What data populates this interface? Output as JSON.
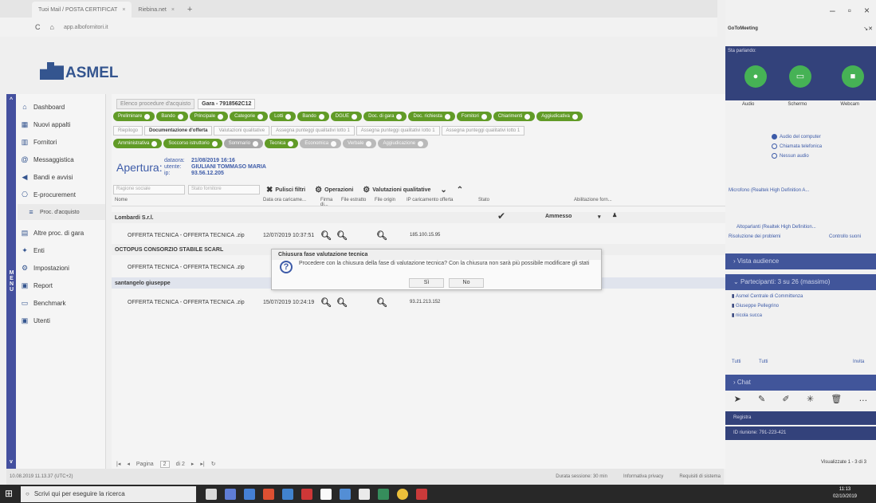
{
  "browser": {
    "tabs": [
      "Tuoi Mail / POSTA CERTIFICAT",
      "Riebina.net"
    ],
    "url": "app.albofornitori.it",
    "nav": [
      "C",
      "⌂"
    ]
  },
  "app": {
    "logo_text": "ASMEL",
    "menu_vertical": "MENU"
  },
  "sidebar": {
    "items": [
      {
        "label": "Dashboard",
        "icon": "home-icon"
      },
      {
        "label": "Nuovi appalti",
        "icon": "grid-icon"
      },
      {
        "label": "Fornitori",
        "icon": "bars-icon"
      },
      {
        "label": "Messaggistica",
        "icon": "email-icon"
      },
      {
        "label": "Bandi e avvisi",
        "icon": "megaphone-icon"
      },
      {
        "label": "E-procurement",
        "icon": "procurement-icon"
      },
      {
        "label": "Proc. d'acquisto",
        "icon": "list-icon",
        "sub": true
      },
      {
        "label": "Altre proc. di gara",
        "icon": "folder-icon"
      },
      {
        "label": "Enti",
        "icon": "org-icon"
      },
      {
        "label": "Impostazioni",
        "icon": "gear-icon"
      },
      {
        "label": "Report",
        "icon": "report-icon"
      },
      {
        "label": "Benchmark",
        "icon": "document-icon"
      },
      {
        "label": "Utenti",
        "icon": "users-icon"
      }
    ]
  },
  "breadcrumbs": [
    "Elenco procedure d'acquisto",
    "Gara - 7918562C12"
  ],
  "green_tabs_1": [
    {
      "label": "Preliminare",
      "state": "ok"
    },
    {
      "label": "Bando",
      "state": "ok"
    },
    {
      "label": "Principale",
      "state": "ok"
    },
    {
      "label": "Categorie",
      "state": "ok"
    },
    {
      "label": "Lotti",
      "state": "ok"
    },
    {
      "label": "Bando",
      "state": "ok"
    },
    {
      "label": "DGUE",
      "state": "ok"
    },
    {
      "label": "Doc. di gara",
      "state": "ok"
    },
    {
      "label": "Doc. richiesta",
      "state": "ok"
    },
    {
      "label": "Fornitori",
      "state": "ok"
    },
    {
      "label": "Chiarimenti",
      "state": "ok"
    },
    {
      "label": "Aggiudicativa",
      "state": "ok"
    }
  ],
  "white_tabs": [
    "Riepilogo",
    "Documentazione d'offerta",
    "Valutazioni qualitative",
    "Assegna punteggi qualitativi lotto 1",
    "Assegna punteggi qualitativi lotto 1",
    "Assegna punteggi qualitativi lotto 1"
  ],
  "green_tabs_2": [
    {
      "label": "Amministrativa",
      "state": "ok"
    },
    {
      "label": "Soccorso istruttorio",
      "state": "ok"
    },
    {
      "label": "Sommario",
      "state": "muted"
    },
    {
      "label": "Tecnica",
      "state": "ok"
    },
    {
      "label": "Economica",
      "state": "dim"
    },
    {
      "label": "Verbale",
      "state": "dim"
    },
    {
      "label": "Aggiudicazione",
      "state": "dim"
    }
  ],
  "apertura": {
    "title": "Apertura:",
    "dataora_label": "dataora:",
    "dataora": "21/08/2019 16:16",
    "utente_label": "utente:",
    "utente": "GIULIANI TOMMASO MARIA",
    "ip_label": "ip:",
    "ip": "93.56.12.205"
  },
  "filters": {
    "search_placeholder": "Ragione sociale",
    "state_placeholder": "Stato fornitore",
    "reset": "Pulisci filtri",
    "operazioni": "Operazioni",
    "valutazioni": "Valutazioni qualitative"
  },
  "table": {
    "headers": [
      "Nome",
      "Data ora caricame...",
      "Firma di...",
      "File estratto",
      "File origin",
      "IP caricamento offerta",
      "Stato",
      "",
      "Abilitazione forn..."
    ],
    "groups": [
      {
        "name": "Lombardi S.r.l.",
        "status": "Ammesso",
        "file": "OFFERTA TECNICA - OFFERTA TECNICA .zip",
        "date": "12/07/2019 10:37:51",
        "ip": "185.100.15.95"
      },
      {
        "name": "OCTOPUS CONSORZIO STABILE SCARL",
        "file": "OFFERTA TECNICA - OFFERTA TECNICA .zip",
        "date": "",
        "ip": ""
      },
      {
        "name": "santangelo giuseppe",
        "file": "OFFERTA TECNICA - OFFERTA TECNICA .zip",
        "date": "15/07/2019 10:24:19",
        "ip": "93.21.213.152"
      }
    ]
  },
  "dialog": {
    "title": "Chiusura fase valutazione tecnica",
    "message": "Procedere con la chiusura della fase di valutazione tecnica? Con la chiusura non sarà più possibile modificare gli stati",
    "yes": "Sì",
    "no": "No"
  },
  "pager": {
    "page_label": "Pagina",
    "page": "2",
    "of": "di 2",
    "visual": "Visualizzate 1 - 3 di 3"
  },
  "footer": {
    "left": "10.08.2019 11.13.37 (UTC+2)",
    "session": "Durata sessione: 30 min",
    "privacy": "Informativa privacy",
    "req": "Requisiti di sistema"
  },
  "goto": {
    "title": "GoToMeeting",
    "speaking": "Sta parlando:",
    "audio": "Audio",
    "screen": "Schermo",
    "webcam": "Webcam",
    "opt1": "Audio del computer",
    "opt2": "Chiamata telefonica",
    "opt3": "Nessun audio",
    "mic": "Microfono (Realtek High Definition A...",
    "speaker": "Altoparlanti (Realtek High Definition...",
    "troubleshoot": "Risoluzione dei problemi",
    "controls": "Controllo suoni",
    "audience": "Vista audience",
    "participants": "Partecipanti: 3 su 26 (massimo)",
    "people": [
      "Asmel Centrale di Committenza",
      "Giuseppe Pellegrino",
      "nicola succa"
    ],
    "all1": "Tutti",
    "all2": "Tutti",
    "invite": "Invita",
    "chat": "Chat",
    "record": "Registra",
    "meeting_id": "ID riunione: 791-223-421"
  },
  "taskbar": {
    "search": "Scrivi qui per eseguire la ricerca",
    "time": "11:13",
    "date": "02/10/2019"
  }
}
